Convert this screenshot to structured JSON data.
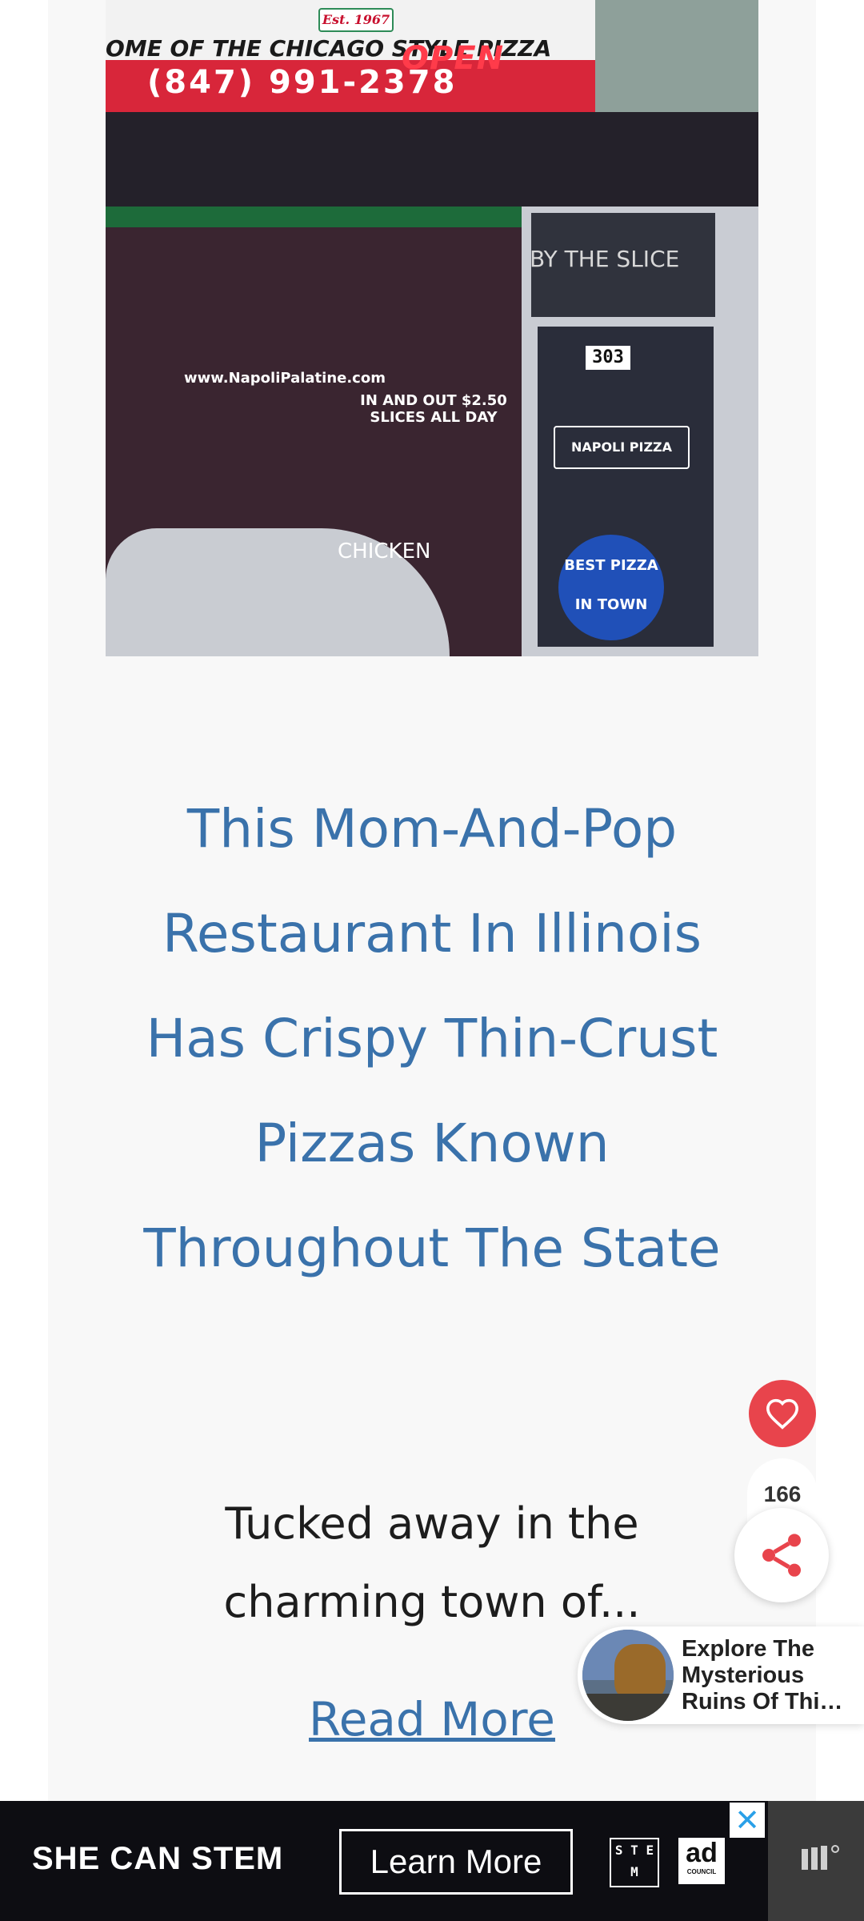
{
  "hero": {
    "sign_est": "Est. 1967",
    "sign_line1": "OME OF THE CHICAGO STYLE PIZZA",
    "sign_phone": "(847) 991-2378",
    "neon_open": "OPEN",
    "url": "www.NapoliPalatine.com",
    "slices": "IN AND OUT $2.50 SLICES ALL DAY",
    "by_the_slice": "BY THE SLICE",
    "door_number": "303",
    "napoli": "NAPOLI PIZZA",
    "chicken": "CHICKEN",
    "best_pizza_top": "BEST PIZZA",
    "best_pizza_bottom": "IN TOWN"
  },
  "article": {
    "headline": "This Mom-And-Pop Restaurant In Illinois Has Crispy Thin-Crust Pizzas Known Throughout The State",
    "excerpt": "Tucked away in the charming town of...",
    "read_more": "Read More"
  },
  "floating": {
    "share_count": "166",
    "explore_text": "Explore The Mysterious Ruins Of Thi…"
  },
  "ad": {
    "headline": "SHE CAN STEM",
    "cta": "Learn More",
    "stem_logo": "S T E M",
    "adcouncil_big": "ad",
    "adcouncil_small": "COUNCIL",
    "close_glyph": "✕"
  },
  "icons": [
    "heart-icon",
    "share-icon",
    "close-icon",
    "brand-icon"
  ],
  "colors": {
    "headline": "#3a72ab",
    "heart": "#e8444c",
    "share": "#e8444c",
    "ad_bg": "#0d0d12",
    "ad_close": "#2aa0e8"
  }
}
